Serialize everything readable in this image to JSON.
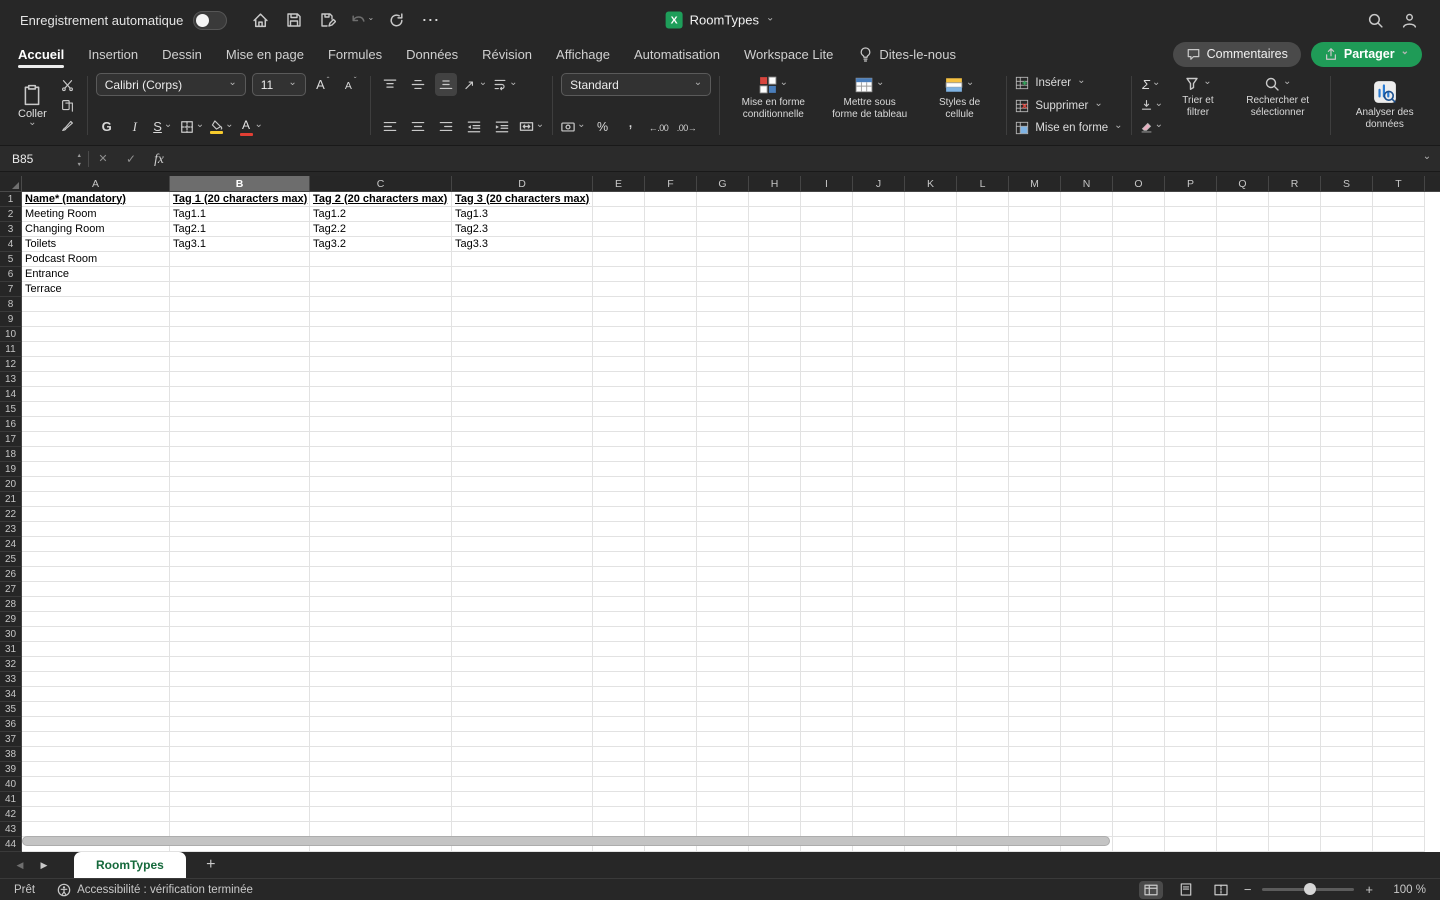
{
  "titlebar": {
    "autosave_label": "Enregistrement automatique",
    "doc_title": "RoomTypes"
  },
  "menu": {
    "tabs": [
      {
        "id": "accueil",
        "label": "Accueil",
        "active": true
      },
      {
        "id": "insertion",
        "label": "Insertion"
      },
      {
        "id": "dessin",
        "label": "Dessin"
      },
      {
        "id": "mise-en-page",
        "label": "Mise en page"
      },
      {
        "id": "formules",
        "label": "Formules"
      },
      {
        "id": "donnees",
        "label": "Données"
      },
      {
        "id": "revision",
        "label": "Révision"
      },
      {
        "id": "affichage",
        "label": "Affichage"
      },
      {
        "id": "automatisation",
        "label": "Automatisation"
      },
      {
        "id": "workspace-lite",
        "label": "Workspace Lite"
      }
    ],
    "tell_me": "Dites-le-nous",
    "comments": "Commentaires",
    "share": "Partager"
  },
  "ribbon": {
    "paste": "Coller",
    "font_name": "Calibri (Corps)",
    "font_size": "11",
    "bold": "G",
    "italic": "I",
    "underline": "S",
    "number_format": "Standard",
    "conditional_formatting": "Mise en forme conditionnelle",
    "format_as_table": "Mettre sous forme de tableau",
    "cell_styles": "Styles de cellule",
    "insert": "Insérer",
    "delete": "Supprimer",
    "format": "Mise en forme",
    "sort_filter": "Trier et filtrer",
    "find_select": "Rechercher et sélectionner",
    "analyze_data": "Analyser des données"
  },
  "formula_bar": {
    "name_box": "B85",
    "fx": "fx"
  },
  "grid": {
    "columns": [
      "A",
      "B",
      "C",
      "D",
      "E",
      "F",
      "G",
      "H",
      "I",
      "J",
      "K",
      "L",
      "M",
      "N",
      "O",
      "P",
      "Q",
      "R",
      "S",
      "T"
    ],
    "col_widths": {
      "A": 148,
      "B": 140,
      "C": 142,
      "D": 141,
      "E": 52,
      "F": 52,
      "G": 52,
      "H": 52,
      "I": 52,
      "J": 52,
      "K": 52,
      "L": 52,
      "M": 52,
      "N": 52,
      "O": 52,
      "P": 52,
      "Q": 52,
      "R": 52,
      "S": 52,
      "T": 52
    },
    "selected_column": "B",
    "num_rows": 44,
    "header_row": 1,
    "cells": {
      "1": {
        "A": "Name* (mandatory)",
        "B": "Tag 1 (20 characters max)",
        "C": "Tag 2 (20 characters max)",
        "D": "Tag 3 (20 characters max)"
      },
      "2": {
        "A": "Meeting Room",
        "B": "Tag1.1",
        "C": "Tag1.2",
        "D": "Tag1.3"
      },
      "3": {
        "A": "Changing Room",
        "B": "Tag2.1",
        "C": "Tag2.2",
        "D": "Tag2.3"
      },
      "4": {
        "A": "Toilets",
        "B": "Tag3.1",
        "C": "Tag3.2",
        "D": "Tag3.3"
      },
      "5": {
        "A": "Podcast Room"
      },
      "6": {
        "A": "Entrance"
      },
      "7": {
        "A": "Terrace"
      }
    }
  },
  "sheet_bar": {
    "tabs": [
      {
        "label": "RoomTypes",
        "active": true
      }
    ]
  },
  "status_bar": {
    "ready": "Prêt",
    "accessibility": "Accessibilité : vérification terminée",
    "zoom": "100 %"
  }
}
